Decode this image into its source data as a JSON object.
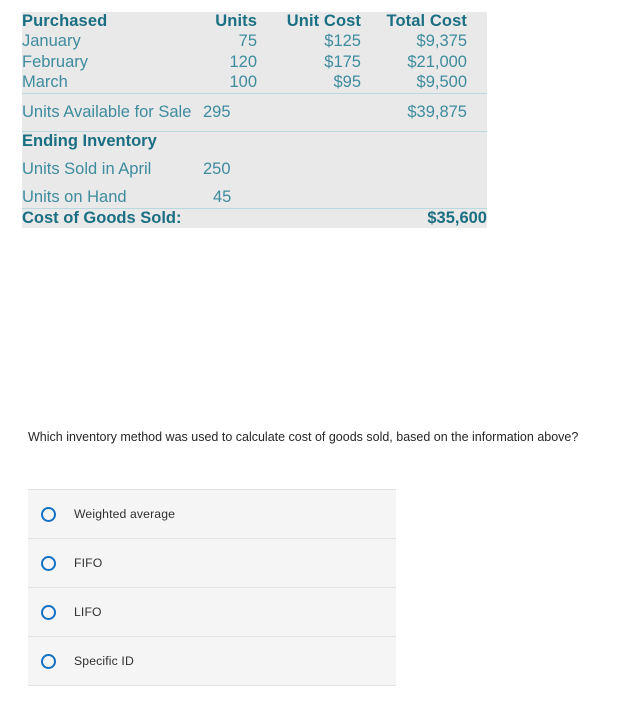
{
  "inventory_table": {
    "background_color": "#e9e9e9",
    "header_color": "#1b6f82",
    "body_color": "#3e8c9e",
    "rule_color": "#b9d8e0",
    "headers": {
      "label": "Purchased",
      "units": "Units",
      "unit_cost": "Unit Cost",
      "total_cost": "Total Cost"
    },
    "purchase_rows": [
      {
        "label": "January",
        "units": "75",
        "unit_cost": "$125",
        "total_cost": "$9,375"
      },
      {
        "label": "February",
        "units": "120",
        "unit_cost": "$175",
        "total_cost": "$21,000"
      },
      {
        "label": "March",
        "units": "100",
        "unit_cost": "$95",
        "total_cost": "$9,500"
      }
    ],
    "available_row": {
      "label": "Units Available for Sale",
      "units": "295",
      "unit_cost": "",
      "total_cost": "$39,875"
    },
    "ending_inventory_heading": "Ending Inventory",
    "ending_rows": [
      {
        "label": "Units Sold in April",
        "units": "250"
      },
      {
        "label": "Units on Hand",
        "units": "45"
      }
    ],
    "cogs_row": {
      "label": "Cost of Goods Sold:",
      "value": "$35,600"
    }
  },
  "question": {
    "text": "Which inventory method was used to calculate cost of goods sold, based on the information above?"
  },
  "answers": {
    "radio_color": "#1371c3",
    "panel_background": "#f5f5f5",
    "selected": null,
    "options": [
      {
        "id": "weighted-average",
        "label": "Weighted average",
        "icon": "radio-unselected-icon"
      },
      {
        "id": "fifo",
        "label": "FIFO",
        "icon": "radio-unselected-icon"
      },
      {
        "id": "lifo",
        "label": "LIFO",
        "icon": "radio-unselected-icon"
      },
      {
        "id": "specific-id",
        "label": "Specific ID",
        "icon": "radio-unselected-icon"
      }
    ]
  }
}
